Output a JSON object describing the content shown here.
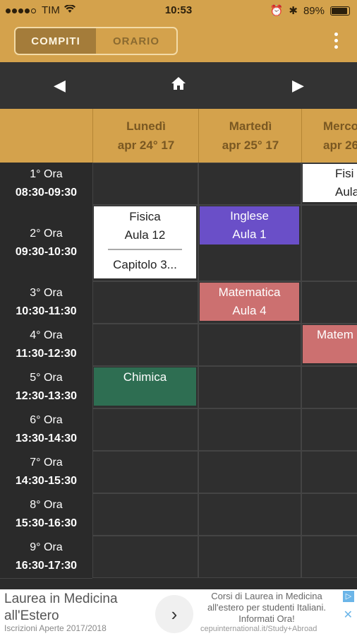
{
  "status": {
    "carrier": "TIM",
    "time": "10:53",
    "battery": "89%"
  },
  "tabs": [
    {
      "label": "COMPITI",
      "active": true
    },
    {
      "label": "ORARIO",
      "active": false
    }
  ],
  "days": [
    {
      "name": "Lunedì",
      "date": "apr 24° 17"
    },
    {
      "name": "Martedì",
      "date": "apr 25° 17"
    },
    {
      "name": "Merco",
      "date": "apr 26"
    }
  ],
  "hours": [
    {
      "label": "1° Ora",
      "time": "08:30-09:30"
    },
    {
      "label": "2° Ora",
      "time": "09:30-10:30"
    },
    {
      "label": "3° Ora",
      "time": "10:30-11:30"
    },
    {
      "label": "4° Ora",
      "time": "11:30-12:30"
    },
    {
      "label": "5° Ora",
      "time": "12:30-13:30"
    },
    {
      "label": "6° Ora",
      "time": "13:30-14:30"
    },
    {
      "label": "7° Ora",
      "time": "14:30-15:30"
    },
    {
      "label": "8° Ora",
      "time": "15:30-16:30"
    },
    {
      "label": "9° Ora",
      "time": "16:30-17:30"
    }
  ],
  "lessons": {
    "mon_fisica": {
      "subject": "Fisica",
      "room": "Aula 12",
      "task": "Capitolo 3..."
    },
    "tue_inglese": {
      "subject": "Inglese",
      "room": "Aula 1"
    },
    "tue_matematica": {
      "subject": "Matematica",
      "room": "Aula 4"
    },
    "mon_chimica": {
      "subject": "Chimica"
    },
    "wed_fisica": {
      "subject": "Fisi",
      "room": "Aula"
    },
    "wed_matematica": {
      "subject": "Matem"
    }
  },
  "ad": {
    "title": "Laurea in Medicina all'Estero",
    "subtitle": "Iscrizioni Aperte 2017/2018",
    "body": "Corsi di Laurea in Medicina all'estero per studenti Italiani. Informati Ora!",
    "url": "cepuinternational.it/Study+Abroad"
  },
  "colors": {
    "gold": "#d4a24c",
    "inglese": "#6a4fc8",
    "matematica": "#cc7070",
    "chimica": "#2e6e52"
  }
}
